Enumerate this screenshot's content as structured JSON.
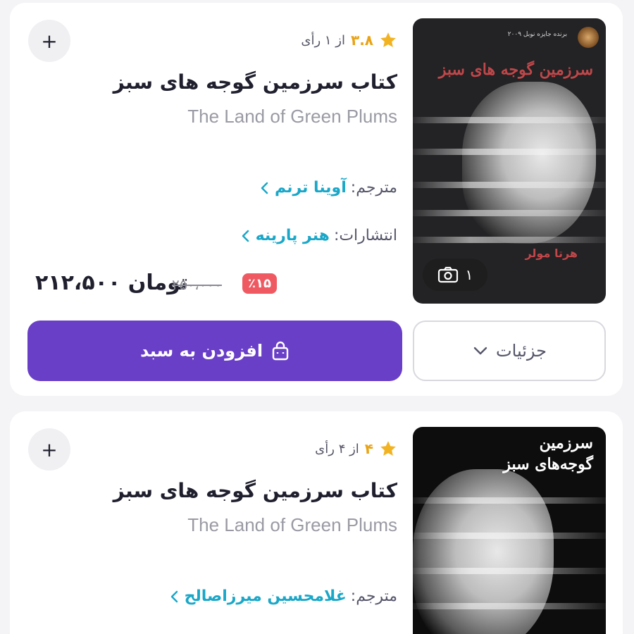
{
  "books": [
    {
      "rating_score": "۳.۸",
      "rating_count": "از ۱ رأی",
      "title": "کتاب سرزمین گوجه های سبز",
      "subtitle": "The Land of Green Plums",
      "translator_label": "مترجم:",
      "translator": "آوینا ترنم",
      "publisher_label": "انتشارات:",
      "publisher": "هنر پارینه",
      "discount": "٪۱۵",
      "old_price": "۲۵۰،۰۰۰",
      "final_price": "۲۱۲،۵۰۰ تومان",
      "photo_count": "۱",
      "cover_title": "سرزمین گوجه های سبز",
      "cover_author": "هرتا مولر",
      "cover_top_text": "برنده جایزه نوبل ۲۰۰۹",
      "add_to_cart": "افزودن به سبد",
      "details": "جزئیات",
      "add_symbol": "+"
    },
    {
      "rating_score": "۴",
      "rating_count": "از ۴ رأی",
      "title": "کتاب سرزمین گوجه های سبز",
      "subtitle": "The Land of Green Plums",
      "translator_label": "مترجم:",
      "translator": "غلامحسین میرزاصالح",
      "cover_title": "سرزمین\nگوجه‌های سبز",
      "add_symbol": "+"
    }
  ],
  "colors": {
    "accent": "#6a3fc8",
    "link": "#1aa7c8",
    "star": "#e8a317",
    "discount": "#ef5a62"
  },
  "icons": [
    "plus-icon",
    "star-icon",
    "chevron-left-icon",
    "camera-icon",
    "bag-icon",
    "chevron-down-icon"
  ]
}
